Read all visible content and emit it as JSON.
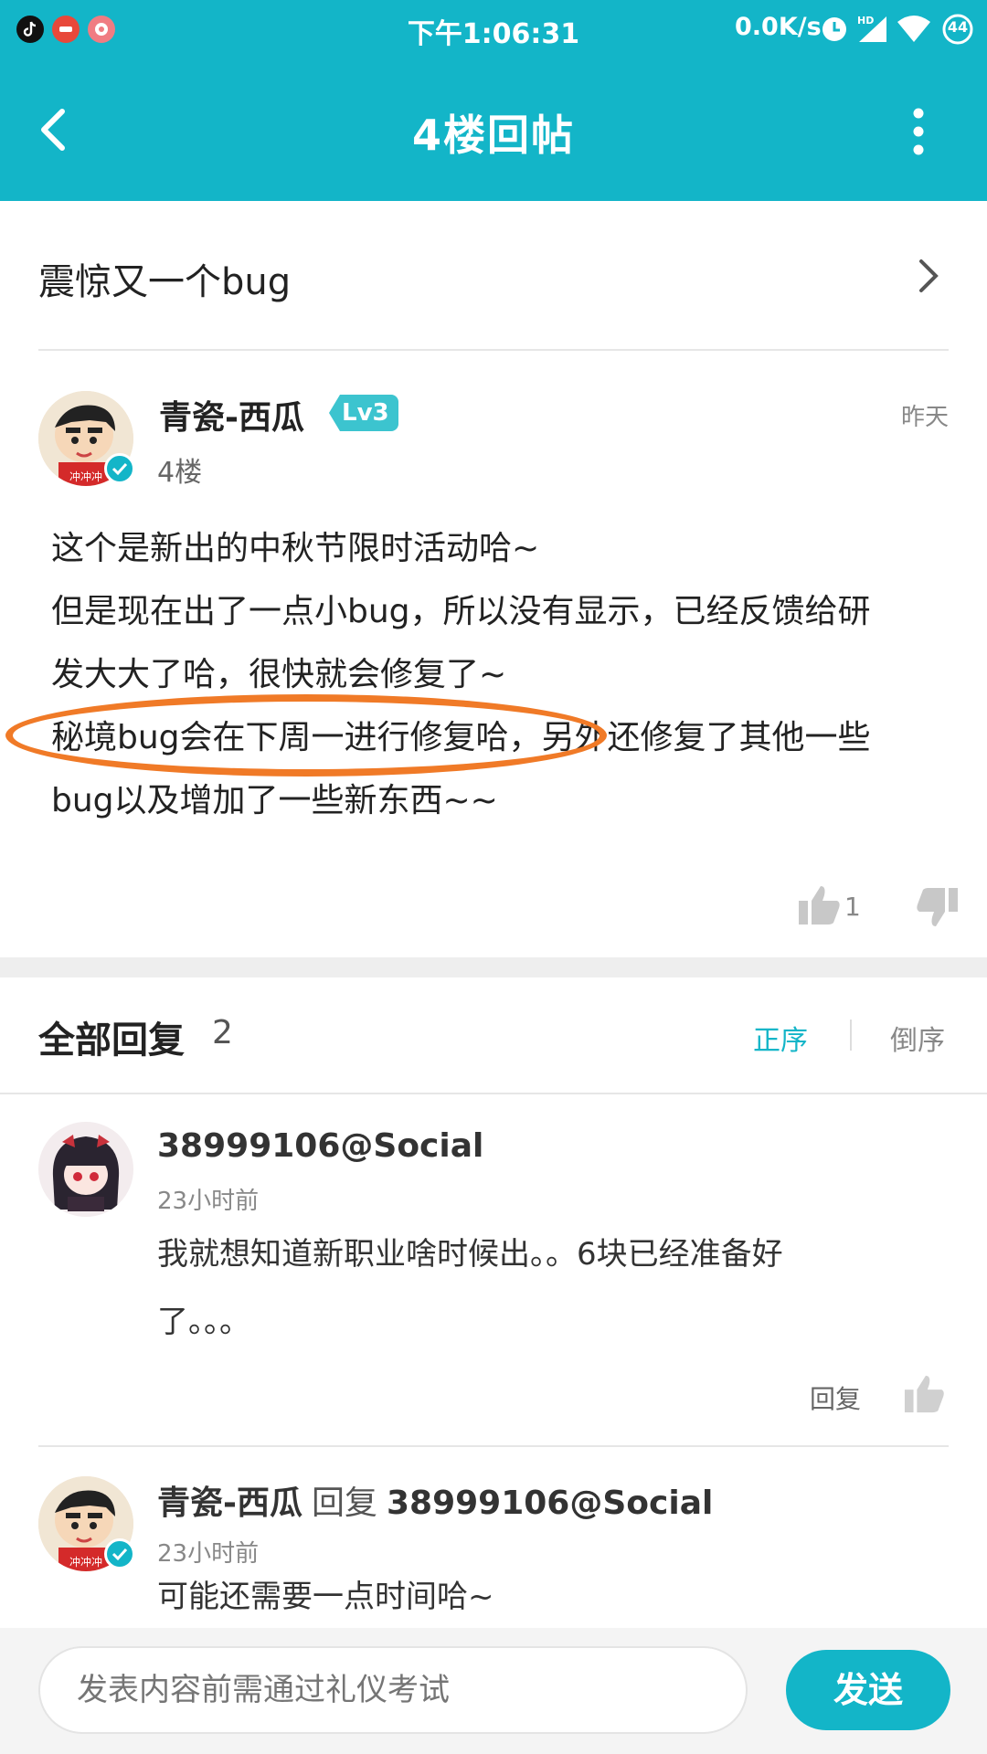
{
  "status_bar": {
    "time": "下午1:06:31",
    "network_speed": "0.0K/s",
    "battery": "44",
    "colors": {
      "background": "#13b5c8"
    },
    "app_icons": [
      "tiktok-icon",
      "app-red-icon",
      "app-pink-icon"
    ]
  },
  "header": {
    "title": "4楼回帖",
    "back_icon": "back-arrow-icon",
    "more_icon": "more-vertical-icon"
  },
  "thread": {
    "title": "震惊又一个bug"
  },
  "post": {
    "author": "青瓷-西瓜",
    "level": "Lv3",
    "floor": "4楼",
    "time": "昨天",
    "lines": [
      "这个是新出的中秋节限时活动哈~",
      "但是现在出了一点小bug，所以没有显示，已经反馈给研",
      "发大大了哈，很快就会修复了~",
      "秘境bug会在下周一进行修复哈，另外还修复了其他一些",
      "bug以及增加了一些新东西~~"
    ],
    "likes": "1"
  },
  "replies": {
    "heading": "全部回复",
    "count": "2",
    "sort_asc": "正序",
    "sort_desc": "倒序",
    "items": [
      {
        "author": "38999106@Social",
        "time": "23小时前",
        "lines": [
          "我就想知道新职业啥时候出。。6块已经准备好",
          "了。。。"
        ],
        "reply_label": "回复"
      },
      {
        "author": "青瓷-西瓜",
        "reply_word": "回复",
        "reply_to": "38999106@Social",
        "time": "23小时前",
        "text": "可能还需要一点时间哈~"
      }
    ]
  },
  "composer": {
    "placeholder": "发表内容前需通过礼仪考试",
    "send_label": "发送"
  },
  "annotation": {
    "color": "#f07a27"
  }
}
